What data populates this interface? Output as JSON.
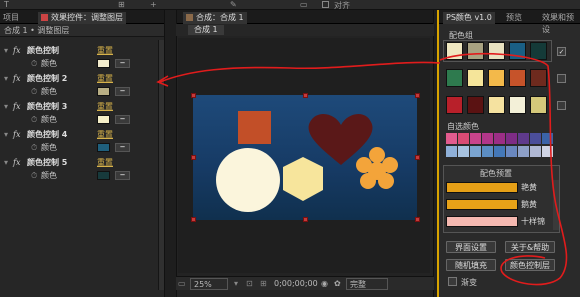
{
  "toolbar": {
    "items": [
      "T",
      "⊞",
      "+",
      "✎",
      "▭"
    ],
    "align_label": "对齐"
  },
  "left_panel": {
    "tabs": [
      "项目",
      "效果控件：调整图层"
    ],
    "breadcrumb": "合成 1 • 调整图层",
    "effects": [
      {
        "name": "颜色控制",
        "reset": "重置",
        "prop": "颜色",
        "color": "#f2eccd"
      },
      {
        "name": "颜色控制 2",
        "reset": "重置",
        "prop": "颜色",
        "color": "#b8ae84"
      },
      {
        "name": "颜色控制 3",
        "reset": "重置",
        "prop": "颜色",
        "color": "#f5efc8"
      },
      {
        "name": "颜色控制 4",
        "reset": "重置",
        "prop": "颜色",
        "color": "#1f5f7c"
      },
      {
        "name": "颜色控制 5",
        "reset": "重置",
        "prop": "颜色",
        "color": "#173a3c"
      }
    ]
  },
  "comp_panel": {
    "tab": "合成：合成 1",
    "sub_tab": "合成 1",
    "zoom": "25%",
    "timecode": "0;00;00;00",
    "quality": "完整"
  },
  "canvas": {
    "bg_top": "#1e4a7a",
    "bg_bottom": "#10304e",
    "square_color": "#c24f28",
    "heart_color": "#5a1818",
    "circle_color": "#fbf5dc",
    "hexagon_color": "#f7e59c",
    "flower_color": "#f3a43a"
  },
  "right_panel": {
    "tabs": [
      "PS颜色 v1.0",
      "预览",
      "效果和预设"
    ],
    "palette_group_label": "配色组",
    "palette_rows": [
      [
        "#efe7c0",
        "#a8a281",
        "#e8e2c0",
        "#1a5f84",
        "#143a38"
      ],
      [
        "#2e7a4e",
        "#f5e59a",
        "#f3b94a",
        "#c6532a",
        "#6e2a1e"
      ],
      [
        "#b8202a",
        "#5a1212",
        "#f5e2a0",
        "#f3f0d8",
        "#d4c87a"
      ]
    ],
    "palette_checked": [
      "✓",
      "",
      ""
    ],
    "custom_label": "自选颜色",
    "custom_grid": [
      [
        "#e25b8e",
        "#d94b74",
        "#c9448c",
        "#b3368a",
        "#9c2e86",
        "#7e2c86",
        "#5f3a8d",
        "#4b4e9a",
        "#3b63a8"
      ],
      [
        "#8fb0d8",
        "#a7c2e0",
        "#7aa4d0",
        "#5c8ec4",
        "#4478b8",
        "#6a88c0",
        "#8ea0c8",
        "#b0b8d4",
        "#d0d4e4"
      ]
    ],
    "preset_label": "配色预置",
    "presets": [
      {
        "name": "艳黄",
        "color": "#e6a017"
      },
      {
        "name": "鹅黄",
        "color": "#e7a218"
      },
      {
        "name": "十样锦",
        "color": "#f4b8b0"
      }
    ],
    "buttons": {
      "ui_settings": "界面设置",
      "about": "关于&帮助",
      "random_fill": "随机填充",
      "color_control": "颜色控制层",
      "gradient": "渐变"
    }
  }
}
